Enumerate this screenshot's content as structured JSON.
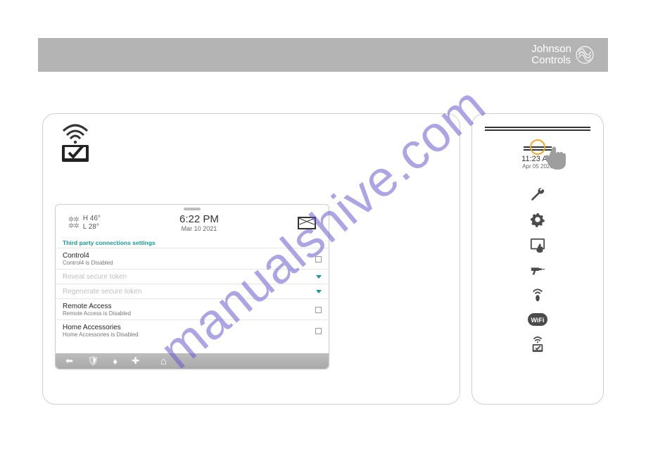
{
  "brand": {
    "line1": "Johnson",
    "line2": "Controls"
  },
  "watermark": "manualshive.com",
  "device": {
    "weather": {
      "hi_label": "H",
      "hi": "46°",
      "lo_label": "L",
      "lo": "28°"
    },
    "clock": {
      "time": "6:22 PM",
      "date": "Mar 10 2021"
    },
    "section_title": "Third party connections settings",
    "rows": [
      {
        "title": "Control4",
        "sub": "Control4 is Disabled",
        "ctrl": "checkbox",
        "disabled": false
      },
      {
        "title": "Reveal secure token",
        "sub": "",
        "ctrl": "dropdown",
        "disabled": true
      },
      {
        "title": "Regenerate secure token",
        "sub": "",
        "ctrl": "dropdown",
        "disabled": true
      },
      {
        "title": "Remote Access",
        "sub": "Remote Access is Disabled",
        "ctrl": "checkbox",
        "disabled": false
      },
      {
        "title": "Home Accessories",
        "sub": "Home Accessories is Disabled",
        "ctrl": "checkbox",
        "disabled": false
      }
    ]
  },
  "side": {
    "time": "11:23 AM",
    "date": "Apr 05 2021"
  }
}
